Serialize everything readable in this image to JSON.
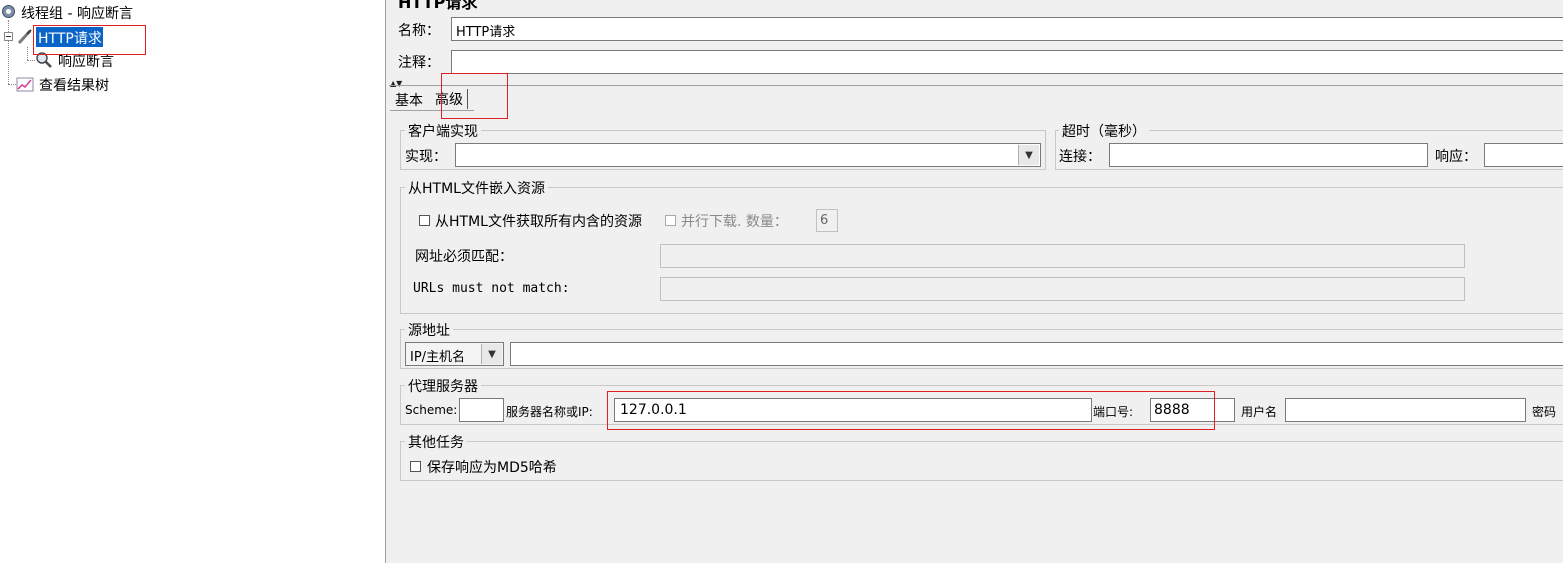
{
  "tree": {
    "root_label": "线程组 - 响应断言",
    "http_request_label": "HTTP请求",
    "assertion_label": "响应断言",
    "results_tree_label": "查看结果树"
  },
  "header": {
    "name_label": "名称：",
    "name_value": "HTTP请求",
    "comment_label": "注释：",
    "comment_value": ""
  },
  "tabs": [
    {
      "label": "基本"
    },
    {
      "label": "高级"
    }
  ],
  "client_impl": {
    "title": "客户端实现",
    "impl_label": "实现：",
    "impl_value": ""
  },
  "timeout": {
    "title": "超时（毫秒）",
    "connect_label": "连接：",
    "connect_value": "",
    "response_label": "响应：",
    "response_value": ""
  },
  "embedded": {
    "title": "从HTML文件嵌入资源",
    "retrieve_all_label": "从HTML文件获取所有内含的资源",
    "retrieve_all_checked": false,
    "parallel_label": "并行下载. 数量：",
    "parallel_checked": false,
    "parallel_count": "6",
    "urls_must_match_label": "网址必须匹配：",
    "urls_must_match_value": "",
    "urls_must_not_match_label": "URLs must not match:",
    "urls_must_not_match_value": ""
  },
  "source_address": {
    "title": "源地址",
    "type_selected": "IP/主机名",
    "value": ""
  },
  "proxy": {
    "title": "代理服务器",
    "scheme_label": "Scheme:",
    "scheme_value": "",
    "server_label": "服务器名称或IP:",
    "server_value": "127.0.0.1",
    "port_label": "端口号:",
    "port_value": "8888",
    "username_label": "用户名",
    "username_value": "",
    "password_label": "密码"
  },
  "other_tasks": {
    "title": "其他任务",
    "md5_label": "保存响应为MD5哈希",
    "md5_checked": false
  },
  "colors": {
    "selection": "#0a64c8",
    "highlight_box": "#e02020",
    "panel_bg": "#f0f0f0"
  }
}
